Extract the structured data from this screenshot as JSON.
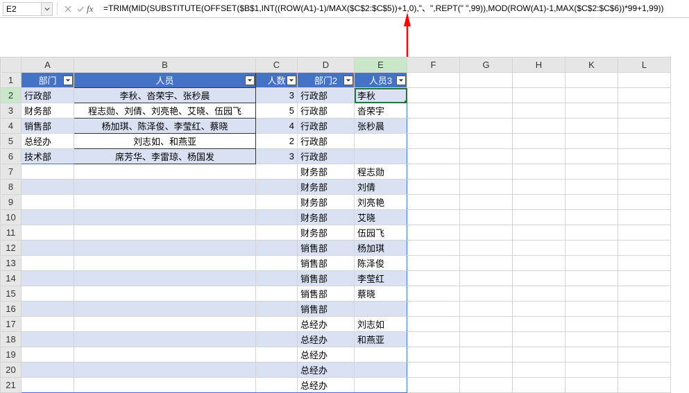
{
  "namebox": "E2",
  "formula": "=TRIM(MID(SUBSTITUTE(OFFSET($B$1,INT((ROW(A1)-1)/MAX($C$2:$C$5))+1,0),\"、\",REPT(\" \",99)),MOD(ROW(A1)-1,MAX($C$2:$C$6))*99+1,99))",
  "colHeaders": [
    "A",
    "B",
    "C",
    "D",
    "E",
    "F",
    "G",
    "H",
    "K",
    "L"
  ],
  "rowCount": 21,
  "activeRow": 2,
  "activeCol": "E",
  "headers": {
    "A": "部门",
    "B": "人员",
    "C": "人数",
    "D": "部门2",
    "E": "人员3"
  },
  "tableA": [
    {
      "dept": "行政部",
      "people": "李秋、沓荣宇、张秒晨",
      "count": 3
    },
    {
      "dept": "财务部",
      "people": "程志勋、刘倩、刘亮艳、艾晓、伍园飞",
      "count": 5
    },
    {
      "dept": "销售部",
      "people": "杨加琪、陈泽俊、李莹红、蔡晓",
      "count": 4
    },
    {
      "dept": "总经办",
      "people": "刘志如、和燕亚",
      "count": 2
    },
    {
      "dept": "技术部",
      "people": "席芳华、李雷琼、杨国发",
      "count": 3
    }
  ],
  "tableD": [
    {
      "dept2": "行政部",
      "person": "李秋"
    },
    {
      "dept2": "行政部",
      "person": "沓荣宇"
    },
    {
      "dept2": "行政部",
      "person": "张秒晨"
    },
    {
      "dept2": "行政部",
      "person": ""
    },
    {
      "dept2": "行政部",
      "person": ""
    },
    {
      "dept2": "财务部",
      "person": "程志勋"
    },
    {
      "dept2": "财务部",
      "person": "刘倩"
    },
    {
      "dept2": "财务部",
      "person": "刘亮艳"
    },
    {
      "dept2": "财务部",
      "person": "艾晓"
    },
    {
      "dept2": "财务部",
      "person": "伍园飞"
    },
    {
      "dept2": "销售部",
      "person": "杨加琪"
    },
    {
      "dept2": "销售部",
      "person": "陈泽俊"
    },
    {
      "dept2": "销售部",
      "person": "李莹红"
    },
    {
      "dept2": "销售部",
      "person": "蔡晓"
    },
    {
      "dept2": "销售部",
      "person": ""
    },
    {
      "dept2": "总经办",
      "person": "刘志如"
    },
    {
      "dept2": "总经办",
      "person": "和燕亚"
    },
    {
      "dept2": "总经办",
      "person": ""
    },
    {
      "dept2": "总经办",
      "person": ""
    },
    {
      "dept2": "总经办",
      "person": ""
    }
  ]
}
